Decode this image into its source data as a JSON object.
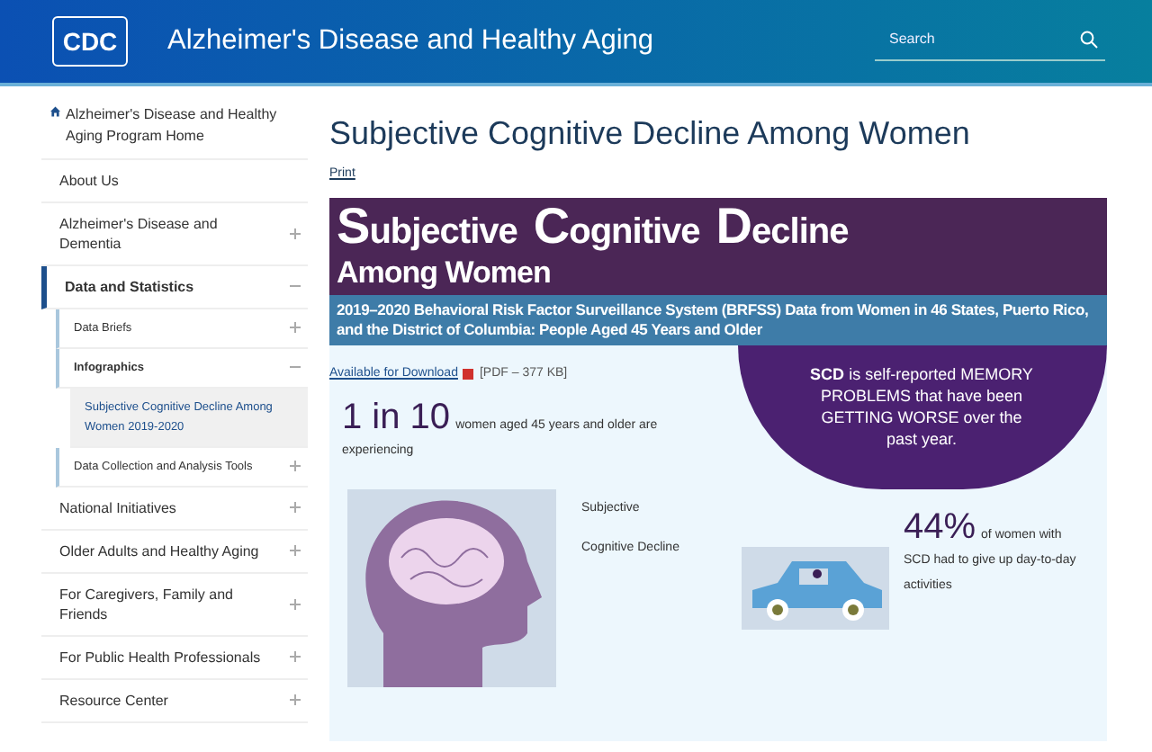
{
  "header": {
    "logo": "CDC",
    "title": "Alzheimer's Disease and Healthy Aging",
    "search": {
      "placeholder": "Search"
    }
  },
  "sidebar": {
    "home": "Alzheimer's Disease and Healthy Aging Program Home",
    "items": [
      {
        "label": "About Us",
        "selected": false
      },
      {
        "label": "Alzheimer's Disease and Dementia",
        "expanded": false,
        "selected": false
      },
      {
        "label": "Data and Statistics",
        "expanded": true,
        "selected": false,
        "children": [
          {
            "label": "Data Briefs",
            "expanded": false,
            "selected": false
          },
          {
            "label": "Infographics",
            "expanded": true,
            "selected": false,
            "children": [
              {
                "label": "Subjective Cognitive Decline Among Women 2019-2020",
                "selected": true
              }
            ]
          },
          {
            "label": "Data Collection and Analysis Tools",
            "expanded": false,
            "selected": false
          }
        ]
      },
      {
        "label": "National Initiatives",
        "expanded": false,
        "selected": false
      },
      {
        "label": "Older Adults and Healthy Aging",
        "expanded": false,
        "selected": false
      },
      {
        "label": "For Caregivers, Family and Friends",
        "expanded": false,
        "selected": false
      },
      {
        "label": "For Public Health Professionals",
        "expanded": false,
        "selected": false
      },
      {
        "label": "Resource Center",
        "expanded": false,
        "selected": false
      }
    ]
  },
  "page": {
    "title": "Subjective Cognitive Decline Among Women",
    "print": "Print",
    "banner": {
      "title_words": [
        "Subjective",
        "Cognitive",
        "Decline"
      ],
      "subtitle": "Among Women",
      "description": "2019–2020 Behavioral Risk Factor Surveillance System (BRFSS) Data from Women in 46 States, Puerto Rico, and the District of Columbia: People Aged 45 Years and Older"
    },
    "download": {
      "link": "Available for Download",
      "size": "[PDF – 377 KB]"
    },
    "definition": "**SCD** is self-reported MEMORY PROBLEMS that have been GETTING WORSE over the past year.",
    "stat1": {
      "value": "1 in 10",
      "text": "women aged 45 years and older are experiencing"
    },
    "scd_label": [
      "Subjective",
      "Cognitive Decline"
    ],
    "stat2": {
      "value": "44%",
      "text": "of women with SCD had to give up day-to-day activities"
    }
  }
}
